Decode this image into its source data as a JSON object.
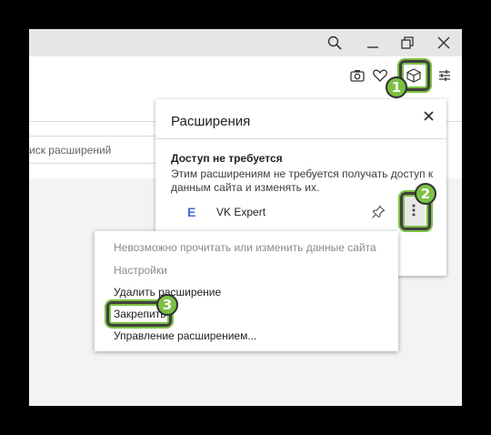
{
  "window": {
    "controls": [
      "search-icon",
      "minimize-icon",
      "restore-icon",
      "close-icon"
    ]
  },
  "toolbar": {
    "icons": [
      "camera-icon",
      "heart-icon",
      "extensions-cube-icon",
      "settings-sliders-icon"
    ]
  },
  "search": {
    "text": "иск расширений"
  },
  "extensions_popup": {
    "title": "Расширения",
    "section_heading": "Доступ не требуется",
    "section_description": "Этим расширениям не требуется получать доступ к данным сайта и изменять их.",
    "extension": {
      "logo": "E",
      "name": "VK Expert"
    }
  },
  "context_menu": {
    "items": [
      {
        "label": "Невозможно прочитать или изменить данные сайта",
        "enabled": false
      },
      {
        "label": "Настройки",
        "enabled": false
      },
      {
        "label": "Удалить расширение",
        "enabled": true
      },
      {
        "label": "Закрепить",
        "enabled": true
      },
      {
        "label": "Управление расширением...",
        "enabled": true
      }
    ]
  },
  "steps": {
    "one": "1",
    "two": "2",
    "three": "3"
  },
  "colors": {
    "highlight": "#7bc043",
    "background": "#000000",
    "accent": "#3f6ad8"
  }
}
